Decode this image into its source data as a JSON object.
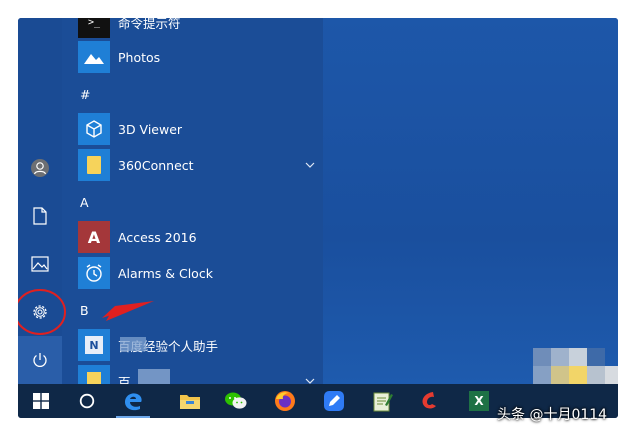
{
  "colors": {
    "accent": "#1b4f9c",
    "taskbar": "#0f2847",
    "annotation": "#e02020",
    "access_red": "#a4373a",
    "folder_yellow": "#f6d35b"
  },
  "start_menu": {
    "rail": {
      "user_icon": "user-avatar-icon",
      "documents_icon": "document-icon",
      "pictures_icon": "pictures-icon",
      "settings_icon": "gear-icon",
      "power_icon": "power-icon"
    },
    "apps": {
      "cmd_label": "命令提示符",
      "photos_label": "Photos",
      "header_hash": "#",
      "viewer_label": "3D Viewer",
      "connect_label": "360Connect",
      "header_a": "A",
      "access_label": "Access 2016",
      "access_tile_text": "A",
      "alarms_label": "Alarms & Clock",
      "header_b": "B",
      "helper_label": "百度经验个人助手",
      "helper_tile_text": "N",
      "last_label": "百"
    }
  },
  "taskbar": {
    "icons": [
      "windows-start-icon",
      "cortana-circle-icon",
      "edge-icon",
      "file-explorer-icon",
      "wechat-icon",
      "firefox-icon",
      "feishu-icon",
      "notepad-icon",
      "red-app-icon",
      "excel-icon"
    ],
    "excel_text": "X"
  },
  "watermark": "头条 @十月0114"
}
